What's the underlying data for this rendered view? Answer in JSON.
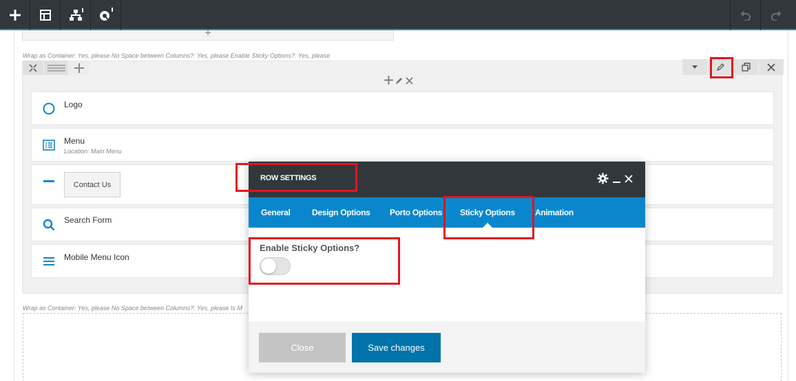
{
  "toolbar": {
    "left_icons": [
      "add-element-icon",
      "templates-icon",
      "sitemap-icon",
      "brand-icon"
    ],
    "right_icons": [
      "undo-icon",
      "redo-icon"
    ]
  },
  "canvas": {
    "meta_line_1": "Wrap as Container: Yes, please  No Space between Columns?: Yes, please  Enable Sticky Options?: Yes, please",
    "meta_line_2": "Wrap as Container: Yes, please  No Space between Columns?: Yes, please  Is M",
    "elements": [
      {
        "title": "Logo",
        "icon": "circle-icon"
      },
      {
        "title": "Menu",
        "subtitle": "Location: Main Menu",
        "icon": "list-icon"
      },
      {
        "title": "",
        "button_label": "Contact Us",
        "icon": "minus-icon"
      },
      {
        "title": "Search Form",
        "icon": "search-icon"
      },
      {
        "title": "Mobile Menu Icon",
        "icon": "hamburger-icon"
      }
    ]
  },
  "modal": {
    "title": "ROW SETTINGS",
    "tabs": [
      {
        "label": "General"
      },
      {
        "label": "Design Options"
      },
      {
        "label": "Porto Options"
      },
      {
        "label": "Sticky Options",
        "active": true
      },
      {
        "label": "Animation"
      }
    ],
    "field_label": "Enable Sticky Options?",
    "toggle_on": false,
    "close_label": "Close",
    "save_label": "Save changes"
  },
  "colors": {
    "toolbar_bg": "#32373c",
    "tab_bar": "#0a87cc",
    "accent_icon": "#0c86c7",
    "save_button": "#0073aa",
    "highlight": "#e3141e"
  }
}
